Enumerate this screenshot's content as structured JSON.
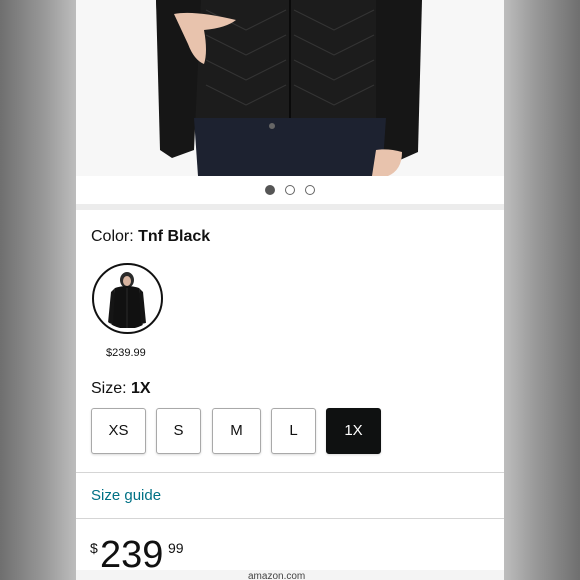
{
  "gallery": {
    "dot_count": 3,
    "active_index": 0
  },
  "color": {
    "label": "Color: ",
    "value": "Tnf Black"
  },
  "swatch": {
    "price": "$239.99"
  },
  "size": {
    "label": "Size: ",
    "value": "1X",
    "options": [
      "XS",
      "S",
      "M",
      "L",
      "1X"
    ],
    "selected": "1X"
  },
  "size_guide": "Size guide",
  "price": {
    "currency": "$",
    "whole": "239",
    "fraction": "99"
  },
  "browser": {
    "url": "amazon.com"
  },
  "colors": {
    "link": "#007185",
    "selected_bg": "#0f1111"
  }
}
